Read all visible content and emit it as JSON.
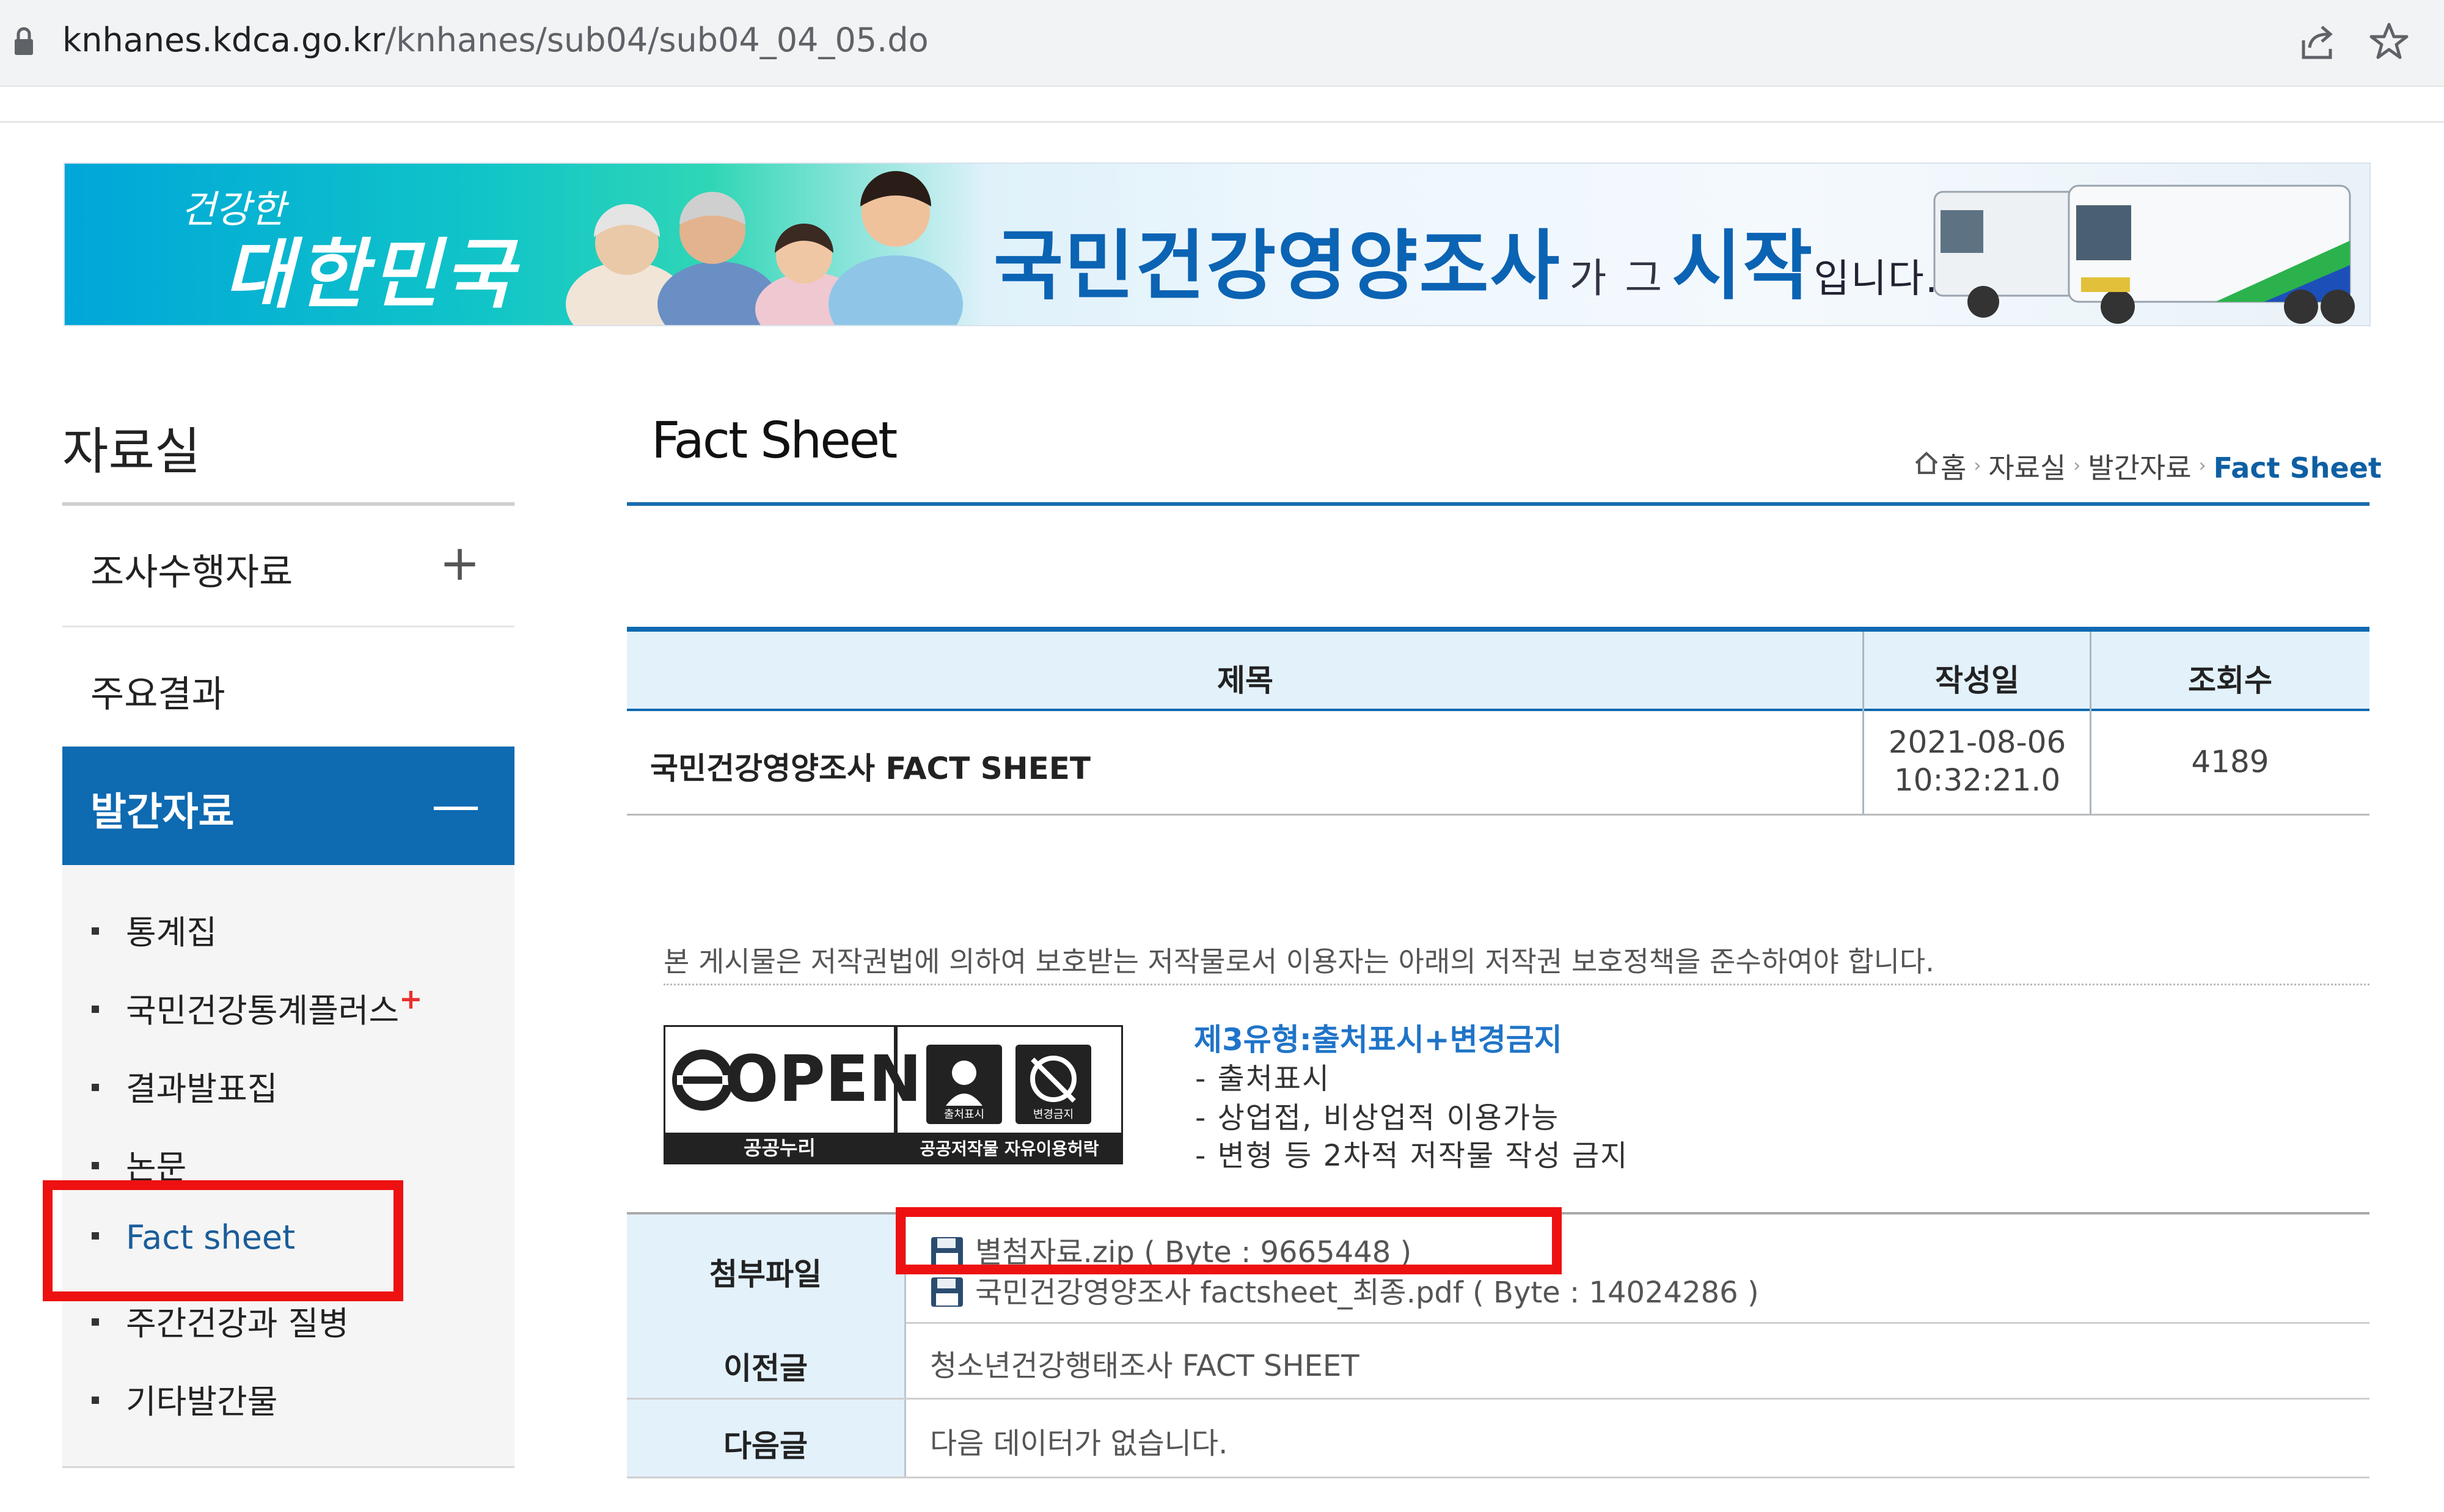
{
  "browser": {
    "url_host": "knhanes.kdca.go.kr",
    "url_path": "/knhanes/sub04/sub04_04_05.do",
    "icons": [
      "lock-icon",
      "share-icon",
      "star-icon"
    ]
  },
  "banner": {
    "slogan_line1": "건강한",
    "slogan_line2": "대한민국",
    "title_main": "국민건강영양조사",
    "title_ga": "가",
    "title_geu": "그",
    "title_start": "시작",
    "title_end": "입니다."
  },
  "sidebar": {
    "title": "자료실",
    "menu": [
      {
        "label": "조사수행자료",
        "sign": "+"
      },
      {
        "label": "주요결과",
        "sign": ""
      },
      {
        "label": "발간자료",
        "sign": "—"
      }
    ],
    "submenu": [
      {
        "label": "통계집"
      },
      {
        "label": "국민건강통계플러스",
        "badge": "+"
      },
      {
        "label": "결과발표집"
      },
      {
        "label": "논문"
      },
      {
        "label": "Fact sheet"
      },
      {
        "label": "주간건강과 질병"
      },
      {
        "label": "기타발간물"
      }
    ]
  },
  "page": {
    "title": "Fact Sheet",
    "breadcrumb": [
      "홈",
      "자료실",
      "발간자료",
      "Fact Sheet"
    ]
  },
  "board": {
    "headers": [
      "제목",
      "작성일",
      "조회수"
    ],
    "row": {
      "title": "국민건강영양조사 FACT SHEET",
      "date_line1": "2021-08-06",
      "date_line2": "10:32:21.0",
      "views": "4189"
    }
  },
  "copyright": {
    "notice": "본 게시물은 저작권법에 의하여 보호받는 저작물로서 이용자는 아래의 저작권 보호정책을 준수하여야 합니다.",
    "logo_open": "OPEN",
    "logo_left_caption": "공공누리",
    "logo_right_caption": "공공저작물 자유이용허락",
    "logo_badge1": "출처표시",
    "logo_badge2": "변경금지",
    "license_title": "제3유형:출처표시+변경금지",
    "license_items": [
      "- 출처표시",
      "- 상업접, 비상업적 이용가능",
      "- 변형 등 2차적 저작물 작성 금지"
    ]
  },
  "attachments": {
    "label": "첨부파일",
    "files": [
      "별첨자료.zip ( Byte : 9665448 )",
      "국민건강영양조사 factsheet_최종.pdf ( Byte : 14024286 )"
    ]
  },
  "prev": {
    "label": "이전글",
    "value": "청소년건강행태조사 FACT SHEET"
  },
  "next": {
    "label": "다음글",
    "value": "다음 데이터가 없습니다."
  },
  "colors": {
    "accent": "#0e6ab1",
    "highlight_box": "#ee1111",
    "table_header_bg": "#e3f1fb"
  }
}
